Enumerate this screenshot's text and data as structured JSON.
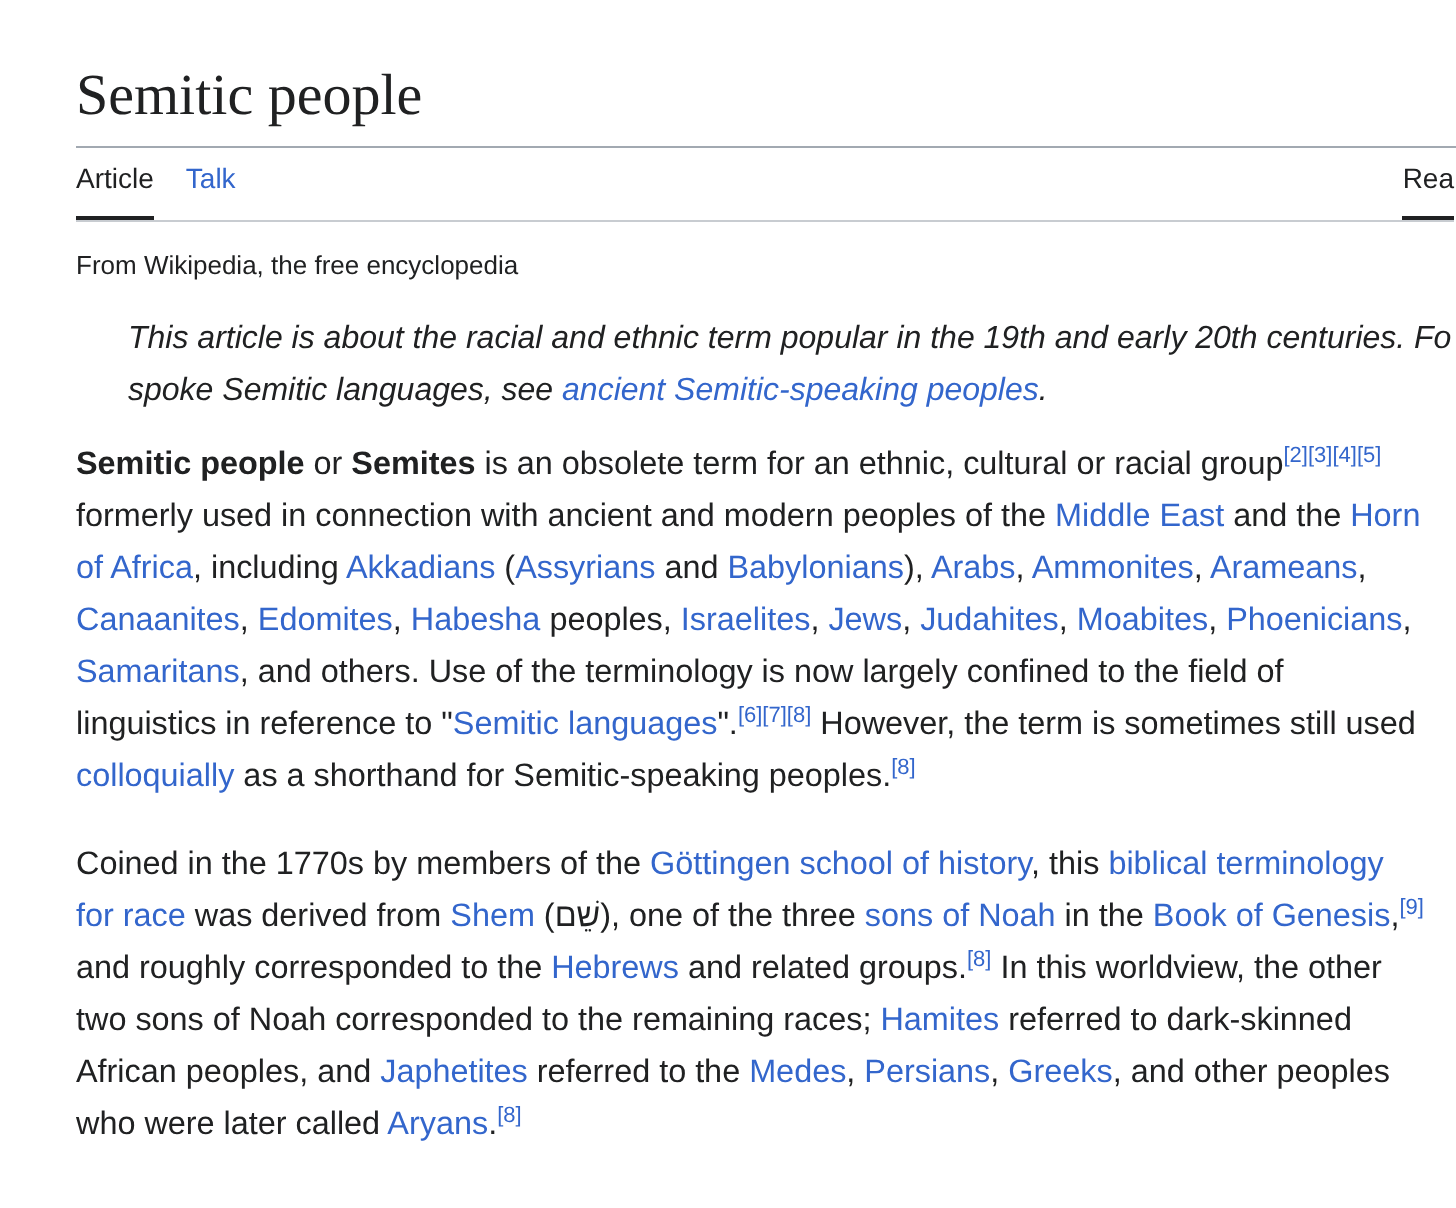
{
  "title": "Semitic people",
  "tabs": [
    {
      "label": "Article",
      "selected": true,
      "kind": "page"
    },
    {
      "label": "Talk",
      "selected": false,
      "kind": "link"
    }
  ],
  "right_tabs": [
    {
      "label": "Rea",
      "selected": true
    }
  ],
  "tagline": "From Wikipedia, the free encyclopedia",
  "hatnote": {
    "line_1": "This article is about the racial and ethnic term popular in the 19th and early 20th centuries. Fo",
    "line_2": [
      {
        "kind": "text",
        "text": "spoke Semitic languages, see "
      },
      {
        "kind": "link",
        "text": "ancient Semitic-speaking peoples"
      },
      {
        "kind": "text",
        "text": "."
      }
    ]
  },
  "paragraphs": [
    [
      {
        "kind": "bold",
        "text": "Semitic people"
      },
      {
        "kind": "text",
        "text": " or "
      },
      {
        "kind": "bold",
        "text": "Semites"
      },
      {
        "kind": "text",
        "text": " is an obsolete term for an ethnic, cultural or racial group"
      },
      {
        "kind": "ref",
        "text": "[2]"
      },
      {
        "kind": "ref",
        "text": "[3]"
      },
      {
        "kind": "ref",
        "text": "[4]"
      },
      {
        "kind": "ref",
        "text": "[5]"
      },
      {
        "kind": "text",
        "text": " formerly used in connection with ancient and modern peoples of the "
      },
      {
        "kind": "link",
        "text": "Middle East"
      },
      {
        "kind": "text",
        "text": " and the "
      },
      {
        "kind": "link",
        "text": "Horn"
      },
      {
        "kind": "link",
        "text": "of Africa",
        "gap": true
      },
      {
        "kind": "text",
        "text": ", including "
      },
      {
        "kind": "link",
        "text": "Akkadians"
      },
      {
        "kind": "text",
        "text": " ("
      },
      {
        "kind": "link",
        "text": "Assyrians"
      },
      {
        "kind": "text",
        "text": " and "
      },
      {
        "kind": "link",
        "text": "Babylonians"
      },
      {
        "kind": "text",
        "text": "), "
      },
      {
        "kind": "link",
        "text": "Arabs"
      },
      {
        "kind": "text",
        "text": ", "
      },
      {
        "kind": "link",
        "text": "Ammonites"
      },
      {
        "kind": "text",
        "text": ", "
      },
      {
        "kind": "link",
        "text": "Arameans"
      },
      {
        "kind": "text",
        "text": ", "
      },
      {
        "kind": "link",
        "text": "Canaanites"
      },
      {
        "kind": "text",
        "text": ", "
      },
      {
        "kind": "link",
        "text": "Edomites"
      },
      {
        "kind": "text",
        "text": ", "
      },
      {
        "kind": "link",
        "text": "Habesha"
      },
      {
        "kind": "text",
        "text": " peoples, "
      },
      {
        "kind": "link",
        "text": "Israelites"
      },
      {
        "kind": "text",
        "text": ", "
      },
      {
        "kind": "link",
        "text": "Jews"
      },
      {
        "kind": "text",
        "text": ", "
      },
      {
        "kind": "link",
        "text": "Judahites"
      },
      {
        "kind": "text",
        "text": ", "
      },
      {
        "kind": "link",
        "text": "Moabites"
      },
      {
        "kind": "text",
        "text": ", "
      },
      {
        "kind": "link",
        "text": "Phoenicians"
      },
      {
        "kind": "text",
        "text": ", "
      },
      {
        "kind": "link",
        "text": "Samaritans"
      },
      {
        "kind": "text",
        "text": ", and others. Use of the terminology is now largely confined to the field of linguistics in reference to \""
      },
      {
        "kind": "link",
        "text": "Semitic languages"
      },
      {
        "kind": "text",
        "text": "\"."
      },
      {
        "kind": "ref",
        "text": "[6]"
      },
      {
        "kind": "ref",
        "text": "[7]"
      },
      {
        "kind": "ref",
        "text": "[8]"
      },
      {
        "kind": "text",
        "text": " However, the term is sometimes still used "
      },
      {
        "kind": "link",
        "text": "colloquially"
      },
      {
        "kind": "text",
        "text": " as a shorthand for Semitic-speaking peoples."
      },
      {
        "kind": "ref",
        "text": "[8]"
      }
    ],
    [
      {
        "kind": "text",
        "text": "Coined in the 1770s by members of the "
      },
      {
        "kind": "link",
        "text": "Göttingen school of history"
      },
      {
        "kind": "text",
        "text": ", this "
      },
      {
        "kind": "link",
        "text": "biblical terminology"
      },
      {
        "kind": "link",
        "text": "for race",
        "gap": true
      },
      {
        "kind": "text",
        "text": " was derived from "
      },
      {
        "kind": "link",
        "text": "Shem"
      },
      {
        "kind": "text",
        "text": " (שֵׁם), one of the three "
      },
      {
        "kind": "link",
        "text": "sons of Noah"
      },
      {
        "kind": "text",
        "text": " in the "
      },
      {
        "kind": "link",
        "text": "Book of"
      },
      {
        "kind": "link",
        "text": "Genesis",
        "gap": true
      },
      {
        "kind": "text",
        "text": ","
      },
      {
        "kind": "ref",
        "text": "[9]"
      },
      {
        "kind": "text",
        "text": " and roughly corresponded to the "
      },
      {
        "kind": "link",
        "text": "Hebrews"
      },
      {
        "kind": "text",
        "text": " and related groups."
      },
      {
        "kind": "ref",
        "text": "[8]"
      },
      {
        "kind": "text",
        "text": " In this worldview, the other two sons of Noah corresponded to the remaining races; "
      },
      {
        "kind": "link",
        "text": "Hamites"
      },
      {
        "kind": "text",
        "text": " referred to dark-skinned African peoples, and "
      },
      {
        "kind": "link",
        "text": "Japhetites"
      },
      {
        "kind": "text",
        "text": " referred to the "
      },
      {
        "kind": "link",
        "text": "Medes"
      },
      {
        "kind": "text",
        "text": ", "
      },
      {
        "kind": "link",
        "text": "Persians"
      },
      {
        "kind": "text",
        "text": ", "
      },
      {
        "kind": "link",
        "text": "Greeks"
      },
      {
        "kind": "text",
        "text": ", and other peoples who were later called "
      },
      {
        "kind": "link",
        "text": "Aryans"
      },
      {
        "kind": "text",
        "text": "."
      },
      {
        "kind": "ref",
        "text": "[8]"
      }
    ]
  ]
}
